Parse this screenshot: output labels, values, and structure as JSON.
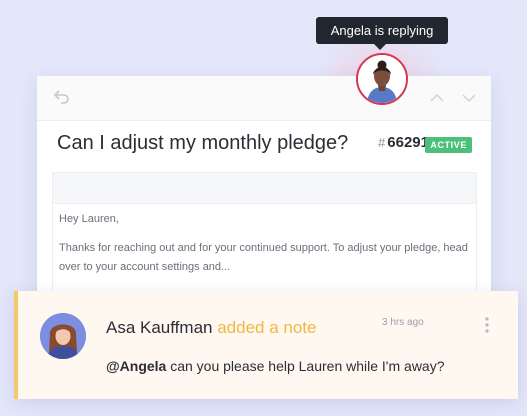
{
  "tooltip": {
    "text": "Angela is replying"
  },
  "ticket": {
    "subject": "Can I adjust my monthly pledge?",
    "hash": "#",
    "number": "66291",
    "status": "ACTIVE",
    "status_color": "#4cc07a"
  },
  "message": {
    "greeting": "Hey Lauren,",
    "body": "Thanks for reaching out and  for your continued support. To adjust your pledge, head over to your account settings and..."
  },
  "note": {
    "author": "Asa Kauffman",
    "action": "added a note",
    "time": "3 hrs ago",
    "mention": "@Angela",
    "text": " can you please help Lauren while I'm away?",
    "accent_color": "#f5c86b"
  },
  "icons": {
    "undo": "undo-icon",
    "prev": "chevron-up-icon",
    "next": "chevron-down-icon",
    "more": "more-vertical-icon"
  }
}
